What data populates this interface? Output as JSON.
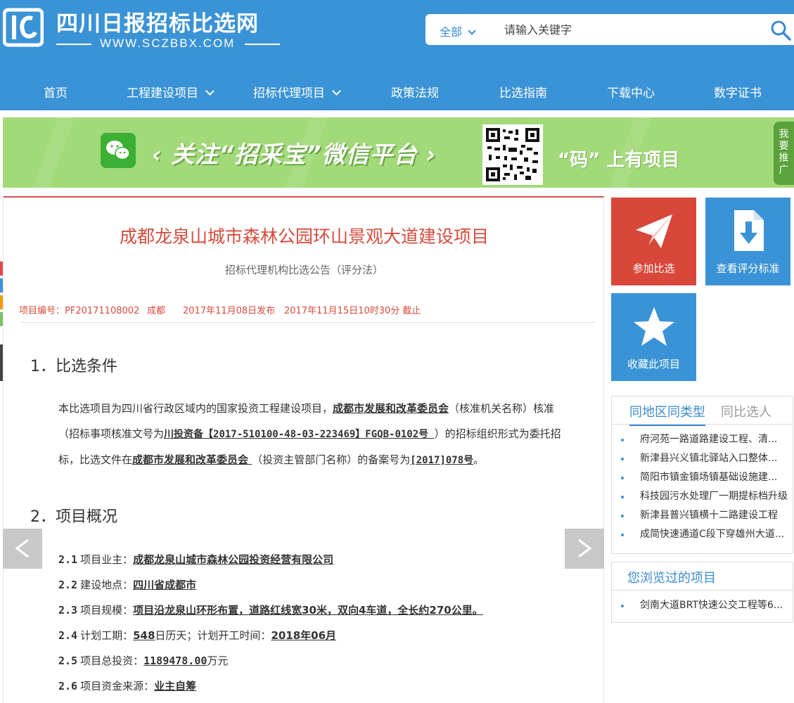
{
  "site": {
    "title": "四川日报招标比选网",
    "url": "WWW.SCZBBX.COM"
  },
  "search": {
    "scope": "全部",
    "placeholder": "请输入关键字"
  },
  "nav": {
    "items": [
      {
        "label": "首页"
      },
      {
        "label": "工程建设项目"
      },
      {
        "label": "招标代理项目"
      },
      {
        "label": "政策法规"
      },
      {
        "label": "比选指南"
      },
      {
        "label": "下载中心"
      },
      {
        "label": "数字证书"
      }
    ]
  },
  "banner": {
    "slogan": "‹ 关注“招采宝”微信平台 ›",
    "tagline": "“码” 上有项目",
    "promo_tab": "我要推广"
  },
  "article": {
    "title": "成都龙泉山城市森林公园环山景观大道建设项目",
    "subtitle": "招标代理机构比选公告（评分法）",
    "meta": {
      "project_no": "项目编号：PF20171108002",
      "region": "成都",
      "published": "2017年11月08日发布",
      "deadline": "2017年11月15日10时30分 截止"
    },
    "section1": {
      "title": "1．比选条件",
      "p1": "本比选项目为四川省行政区域内的国家投资工程建设项目，",
      "approver": "成都市发展和改革委员会",
      "p2": "（核准机关名称）核准",
      "p3": "（招标事项核准文号为",
      "approval_no": "川投资备【2017-510100-48-03-223469】FGQB-0102号 ",
      "p4": "）的招标组织形式为委托招",
      "p5": "标，比选文件在",
      "filer": "成都市发展和改革委员会 ",
      "p6": "（投资主管部门名称）的备案号为",
      "record_no": "[2017]078号",
      "p7": "。"
    },
    "section2": {
      "title": "2．项目概况",
      "rows": [
        {
          "num": "2.1",
          "label": "项目业主：",
          "value": "成都龙泉山城市森林公园投资经营有限公司"
        },
        {
          "num": "2.2",
          "label": "建设地点：",
          "value": "四川省成都市"
        },
        {
          "num": "2.3",
          "label": "项目规模：",
          "value": "项目沿龙泉山环形布置，道路红线宽30米，双向4车道，全长约270公里。"
        },
        {
          "num": "2.4",
          "label": "计划工期：",
          "value": "548",
          "suffix": "日历天；计划开工时间：",
          "value2": "2018年06月"
        },
        {
          "num": "2.5",
          "label": "项目总投资：",
          "value": "1189478.00",
          "suffix": "万元"
        },
        {
          "num": "2.6",
          "label": "项目资金来源：",
          "value": "业主自筹"
        }
      ]
    }
  },
  "sidebar": {
    "actions": [
      {
        "label": "参加比选",
        "color": "#d9473a",
        "icon": "paper-plane-icon"
      },
      {
        "label": "查看评分标准",
        "color": "#3a93d6",
        "icon": "download-doc-icon"
      },
      {
        "label": "收藏此项目",
        "color": "#3a93d6",
        "icon": "star-icon"
      }
    ],
    "related": {
      "tabs": [
        {
          "label": "同地区同类型"
        },
        {
          "label": "同比选人"
        }
      ],
      "items": [
        "府河苑一路道路建设工程、清...",
        "新津县兴义镇北驿站入口整体...",
        "简阳市镇金镇场镇基础设施建...",
        "科技园污水处理厂一期提标档升级",
        "新津县普兴镇横十二路建设工程",
        "成简快速通道C段下穿雄州大道..."
      ]
    },
    "history": {
      "title": "您浏览过的项目",
      "items": [
        "剑南大道BRT快速公交工程等6..."
      ]
    }
  },
  "colors": {
    "header": "#3a93d6",
    "accent_red": "#d64b3c",
    "banner_green": "#a2d979",
    "side_tabs": [
      "#e8464a",
      "#3a93d6",
      "#f39c12",
      "#7cc36b"
    ]
  }
}
